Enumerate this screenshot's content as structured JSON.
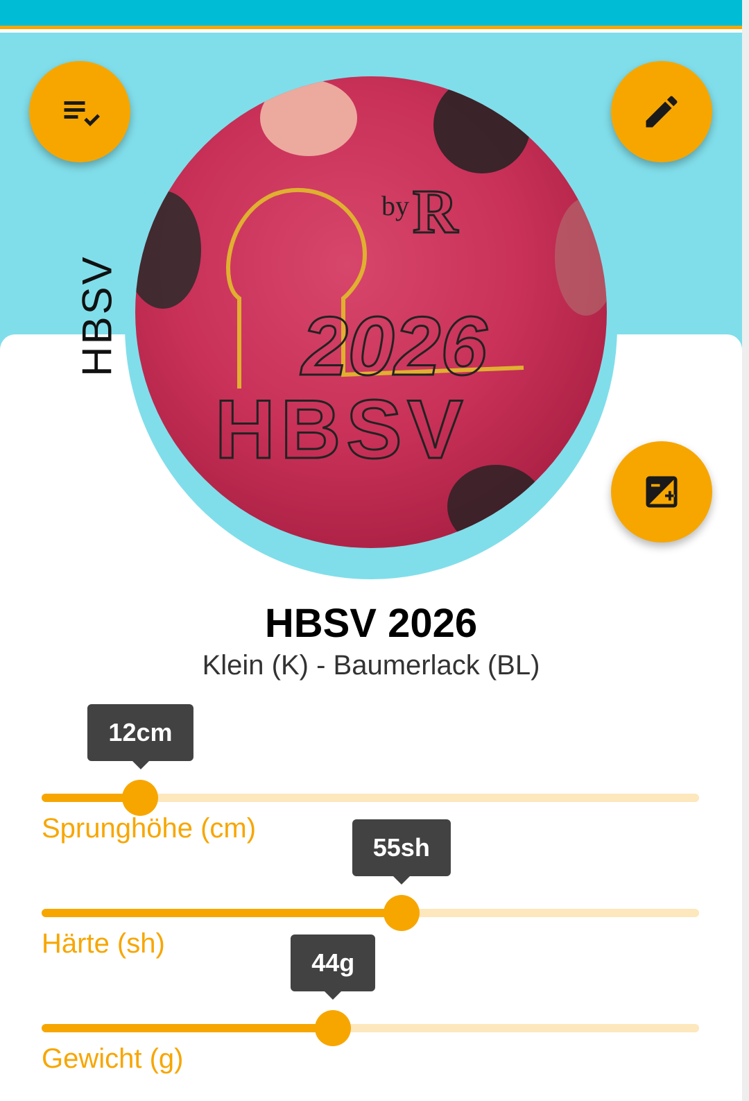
{
  "side_label": "HBSV",
  "ball_print": {
    "by_text": "by",
    "logo_letter": "R",
    "year_text": "2026",
    "name_text": "HBSV"
  },
  "ball": {
    "title": "HBSV 2026",
    "subtitle": "Klein (K) - Baumerlack (BL)"
  },
  "sliders": [
    {
      "key": "jump_height",
      "label": "Sprunghöhe (cm)",
      "value_label": "12cm",
      "value": 12,
      "level": 0.13
    },
    {
      "key": "hardness",
      "label": "Härte (sh)",
      "value_label": "55sh",
      "value": 55,
      "level": 0.55
    },
    {
      "key": "weight",
      "label": "Gewicht (g)",
      "value_label": "44g",
      "value": 44,
      "level": 0.44
    }
  ],
  "icons": {
    "list": "playlist-check-icon",
    "edit": "pencil-icon",
    "image": "image-edit-icon"
  },
  "colors": {
    "status_bar": "#00bcd4",
    "header": "#80deea",
    "accent": "#f7a600",
    "track": "#fde7bd",
    "tooltip": "#424242",
    "ball": "#c93158"
  }
}
